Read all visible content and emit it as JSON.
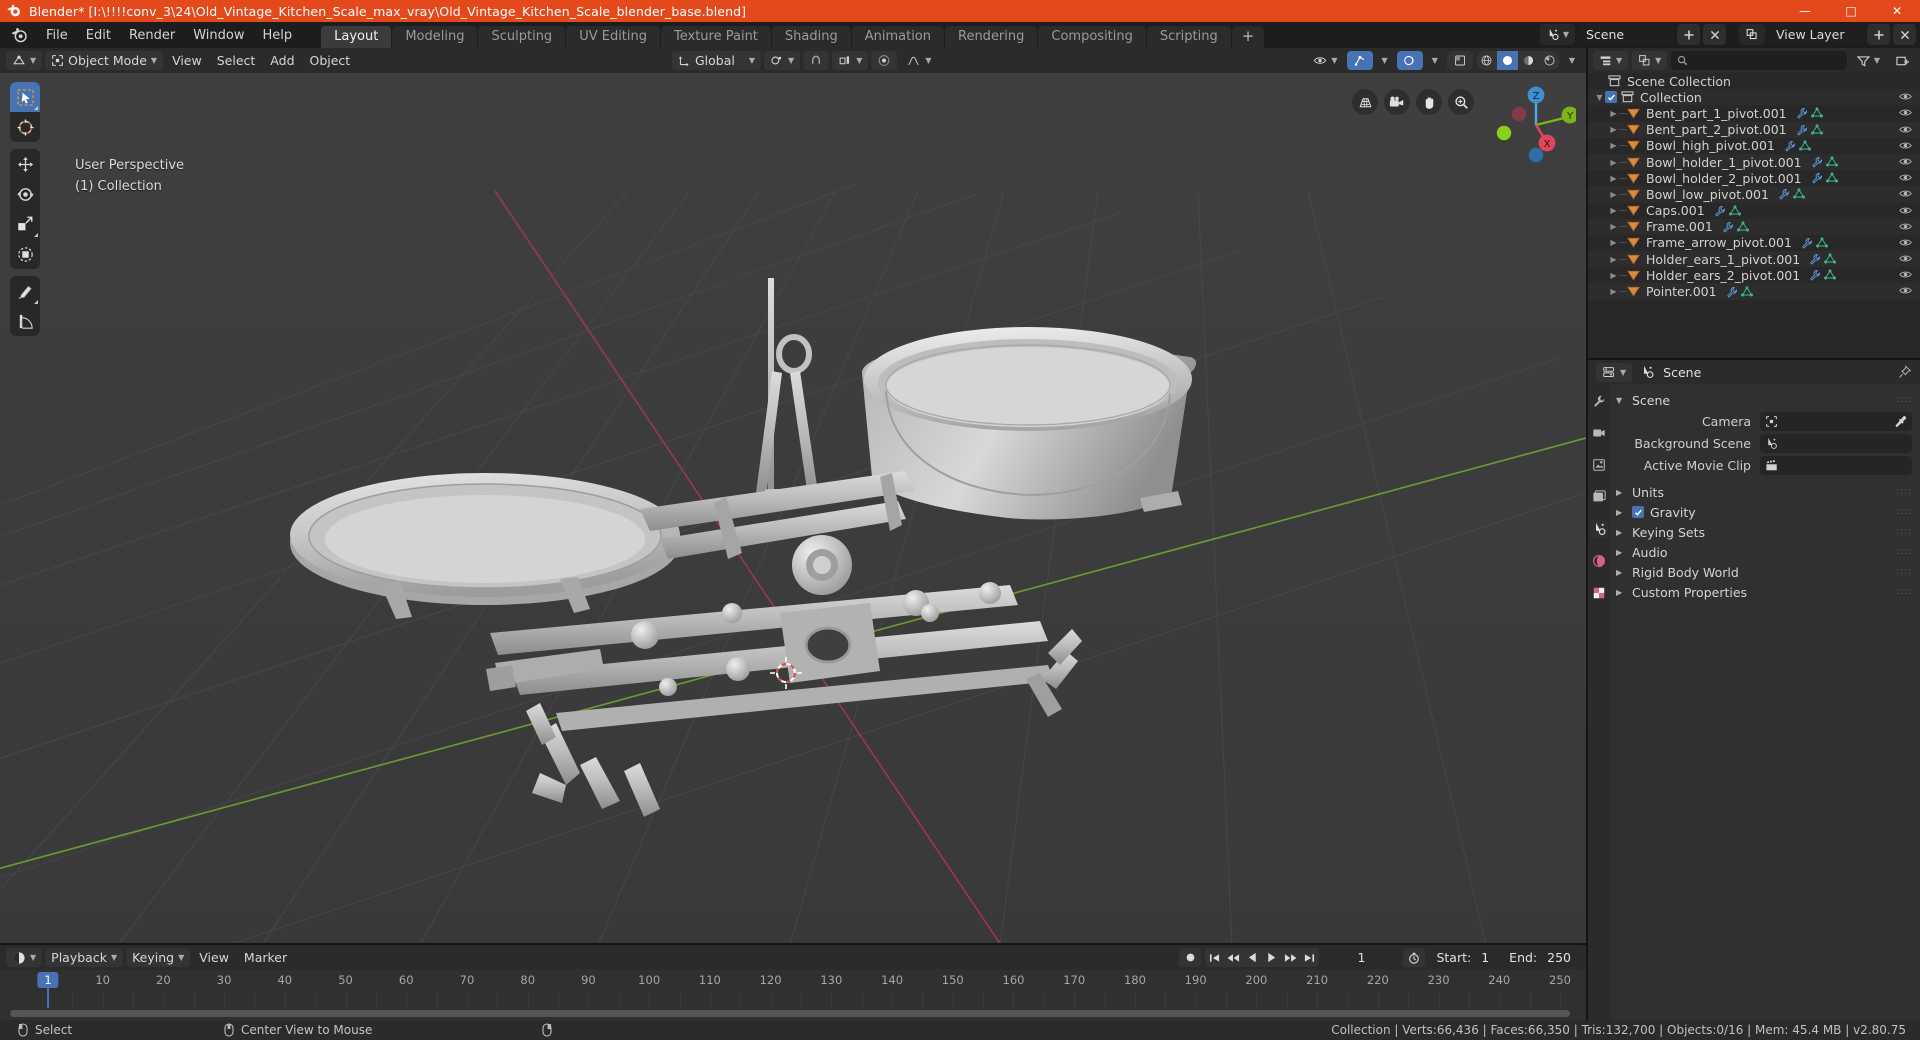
{
  "window": {
    "title": "Blender* [I:\\!!!!conv_3\\24\\Old_Vintage_Kitchen_Scale_max_vray\\Old_Vintage_Kitchen_Scale_blender_base.blend]",
    "minimize": "—",
    "maximize": "□",
    "close": "✕",
    "accent": "#e4491c"
  },
  "menubar": {
    "items": [
      "File",
      "Edit",
      "Render",
      "Window",
      "Help"
    ],
    "workspaces": [
      {
        "label": "Layout",
        "active": true
      },
      {
        "label": "Modeling",
        "active": false
      },
      {
        "label": "Sculpting",
        "active": false
      },
      {
        "label": "UV Editing",
        "active": false
      },
      {
        "label": "Texture Paint",
        "active": false
      },
      {
        "label": "Shading",
        "active": false
      },
      {
        "label": "Animation",
        "active": false
      },
      {
        "label": "Rendering",
        "active": false
      },
      {
        "label": "Compositing",
        "active": false
      },
      {
        "label": "Scripting",
        "active": false
      }
    ],
    "add_workspace": "+",
    "scene_name": "Scene",
    "view_layer_name": "View Layer"
  },
  "viewport_header": {
    "editor_type": "editor-type-icon",
    "mode": "Object Mode",
    "menus": [
      "View",
      "Select",
      "Add",
      "Object"
    ],
    "transform_orientation": "Global",
    "pivot": "pivot-icon",
    "snap": "snap-magnet-icon",
    "proportional": "proportional-edit-icon",
    "falloff": "smooth-falloff-icon"
  },
  "viewport": {
    "perspective_label": "User Perspective",
    "collection_label": "(1) Collection",
    "tools": [
      {
        "name": "tweak-select-box-tool",
        "active": true
      },
      {
        "name": "cursor-tool",
        "active": false
      },
      {
        "name": "move-tool",
        "active": false
      },
      {
        "name": "rotate-tool",
        "active": false
      },
      {
        "name": "scale-tool",
        "active": false
      },
      {
        "name": "transform-tool",
        "active": false
      },
      {
        "name": "annotate-tool",
        "active": false
      },
      {
        "name": "measure-tool",
        "active": false
      }
    ],
    "nav_buttons": [
      "toggle-orthographic-icon",
      "camera-view-icon",
      "pan-view-icon",
      "zoom-view-icon"
    ],
    "axes": {
      "x": "X",
      "y": "Y",
      "z": "Z"
    },
    "background": "#3d3d3d",
    "grid_color": "#4a4a4a",
    "axis_x_color": "#a33b4e",
    "axis_y_color": "#6e9d2f"
  },
  "outliner": {
    "display_mode": "View Layer",
    "search_placeholder": "",
    "root": "Scene Collection",
    "collection": "Collection",
    "items": [
      "Bent_part_1_pivot.001",
      "Bent_part_2_pivot.001",
      "Bowl_high_pivot.001",
      "Bowl_holder_1_pivot.001",
      "Bowl_holder_2_pivot.001",
      "Bowl_low_pivot.001",
      "Caps.001",
      "Frame.001",
      "Frame_arrow_pivot.001",
      "Holder_ears_1_pivot.001",
      "Holder_ears_2_pivot.001",
      "Pointer.001"
    ]
  },
  "properties": {
    "breadcrumb": "Scene",
    "panel_title": "Scene",
    "fields": [
      {
        "label": "Camera",
        "value": "",
        "icon": "camera-object-icon",
        "eyedropper": true
      },
      {
        "label": "Background Scene",
        "value": "",
        "icon": "scene-icon",
        "eyedropper": false
      },
      {
        "label": "Active Movie Clip",
        "value": "",
        "icon": "movie-clip-icon",
        "eyedropper": false
      }
    ],
    "sections": [
      {
        "label": "Units",
        "checkbox": null,
        "open": false
      },
      {
        "label": "Gravity",
        "checkbox": true,
        "open": false
      },
      {
        "label": "Keying Sets",
        "checkbox": null,
        "open": false
      },
      {
        "label": "Audio",
        "checkbox": null,
        "open": false
      },
      {
        "label": "Rigid Body World",
        "checkbox": null,
        "open": false
      },
      {
        "label": "Custom Properties",
        "checkbox": null,
        "open": false
      }
    ],
    "tabs": [
      {
        "name": "tool-tab",
        "active": false
      },
      {
        "name": "render-tab",
        "active": false
      },
      {
        "name": "output-tab",
        "active": false
      },
      {
        "name": "view-layer-tab",
        "active": false
      },
      {
        "name": "scene-tab",
        "active": true
      },
      {
        "name": "world-tab",
        "active": false
      },
      {
        "name": "texture-tab",
        "active": false
      }
    ]
  },
  "timeline": {
    "editor_icon": "timeline-editor-icon",
    "menus": [
      "Playback",
      "Keying",
      "View",
      "Marker"
    ],
    "transport": [
      "jump-to-start",
      "jump-to-prev-keyframe",
      "play-reverse",
      "play",
      "jump-to-next-keyframe",
      "jump-to-end"
    ],
    "record": "auto-keying-icon",
    "current_frame": "1",
    "start_label": "Start:",
    "start_value": "1",
    "end_label": "End:",
    "end_value": "250",
    "ticks": [
      {
        "label": "1",
        "frame": 1
      },
      {
        "label": "10",
        "frame": 10
      },
      {
        "label": "20",
        "frame": 20
      },
      {
        "label": "30",
        "frame": 30
      },
      {
        "label": "40",
        "frame": 40
      },
      {
        "label": "50",
        "frame": 50
      },
      {
        "label": "60",
        "frame": 60
      },
      {
        "label": "70",
        "frame": 70
      },
      {
        "label": "80",
        "frame": 80
      },
      {
        "label": "90",
        "frame": 90
      },
      {
        "label": "100",
        "frame": 100
      },
      {
        "label": "110",
        "frame": 110
      },
      {
        "label": "120",
        "frame": 120
      },
      {
        "label": "130",
        "frame": 130
      },
      {
        "label": "140",
        "frame": 140
      },
      {
        "label": "150",
        "frame": 150
      },
      {
        "label": "160",
        "frame": 160
      },
      {
        "label": "170",
        "frame": 170
      },
      {
        "label": "180",
        "frame": 180
      },
      {
        "label": "190",
        "frame": 190
      },
      {
        "label": "200",
        "frame": 200
      },
      {
        "label": "210",
        "frame": 210
      },
      {
        "label": "220",
        "frame": 220
      },
      {
        "label": "230",
        "frame": 230
      },
      {
        "label": "240",
        "frame": 240
      },
      {
        "label": "250",
        "frame": 250
      }
    ]
  },
  "statusbar": {
    "mouse_left": "Select",
    "mouse_middle": "Center View to Mouse",
    "stats": "Collection | Verts:66,436 | Faces:66,350 | Tris:132,700 | Objects:0/16 | Mem: 45.4 MB | v2.80.75"
  }
}
